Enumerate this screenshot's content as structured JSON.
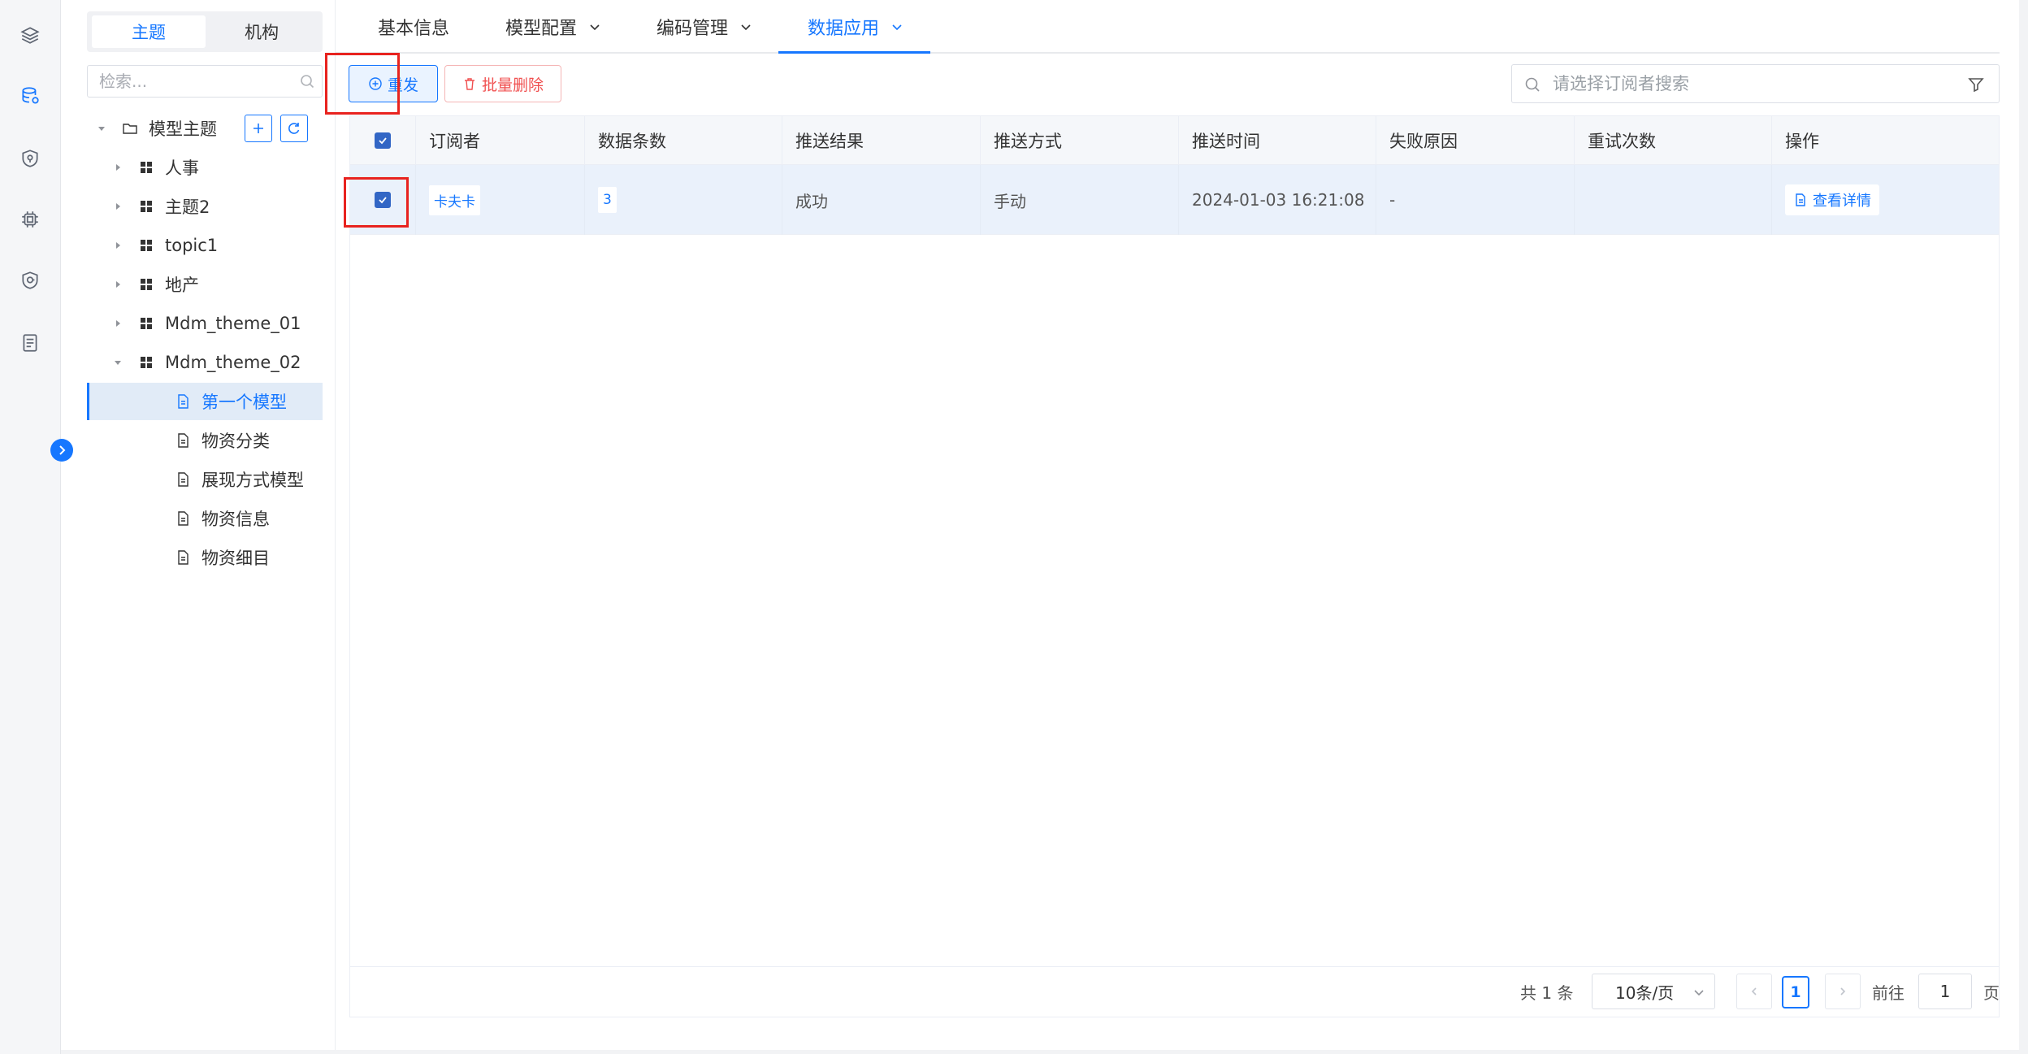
{
  "rail": {
    "icons": [
      "layers-icon",
      "database-icon",
      "shield-icon",
      "chip-icon",
      "security-icon",
      "document-list-icon"
    ]
  },
  "tree_panel": {
    "segment": {
      "tab1": "主题",
      "tab2": "机构"
    },
    "search_placeholder": "检索...",
    "root": {
      "label": "模型主题"
    },
    "nodes": [
      {
        "label": "人事"
      },
      {
        "label": "主题2"
      },
      {
        "label": "topic1"
      },
      {
        "label": "地产"
      },
      {
        "label": "Mdm_theme_01"
      },
      {
        "label": "Mdm_theme_02"
      }
    ],
    "models": [
      {
        "label": "第一个模型",
        "selected": true
      },
      {
        "label": "物资分类"
      },
      {
        "label": "展现方式模型"
      },
      {
        "label": "物资信息"
      },
      {
        "label": "物资细目"
      }
    ]
  },
  "tabs": [
    {
      "label": "基本信息"
    },
    {
      "label": "模型配置"
    },
    {
      "label": "编码管理"
    },
    {
      "label": "数据应用",
      "active": true
    }
  ],
  "toolbar": {
    "resend_label": "重发",
    "delete_label": "批量删除",
    "search_placeholder": "请选择订阅者搜索"
  },
  "table": {
    "columns": [
      "订阅者",
      "数据条数",
      "推送结果",
      "推送方式",
      "推送时间",
      "失败原因",
      "重试次数",
      "操作"
    ],
    "rows": [
      {
        "subscriber": "卡夫卡",
        "count": "3",
        "result": "成功",
        "method": "手动",
        "time": "2024-01-03 16:21:08",
        "reason": "-",
        "retries": "",
        "action": "查看详情"
      }
    ]
  },
  "pagination": {
    "total": "共 1 条",
    "page_size": "10条/页",
    "current": "1",
    "goto_label": "前往",
    "goto_value": "1",
    "page_suffix": "页"
  },
  "colors": {
    "primary": "#1677ff",
    "danger": "#f05050",
    "highlight": "#e8231f",
    "row_selected": "#eaf1fb"
  }
}
